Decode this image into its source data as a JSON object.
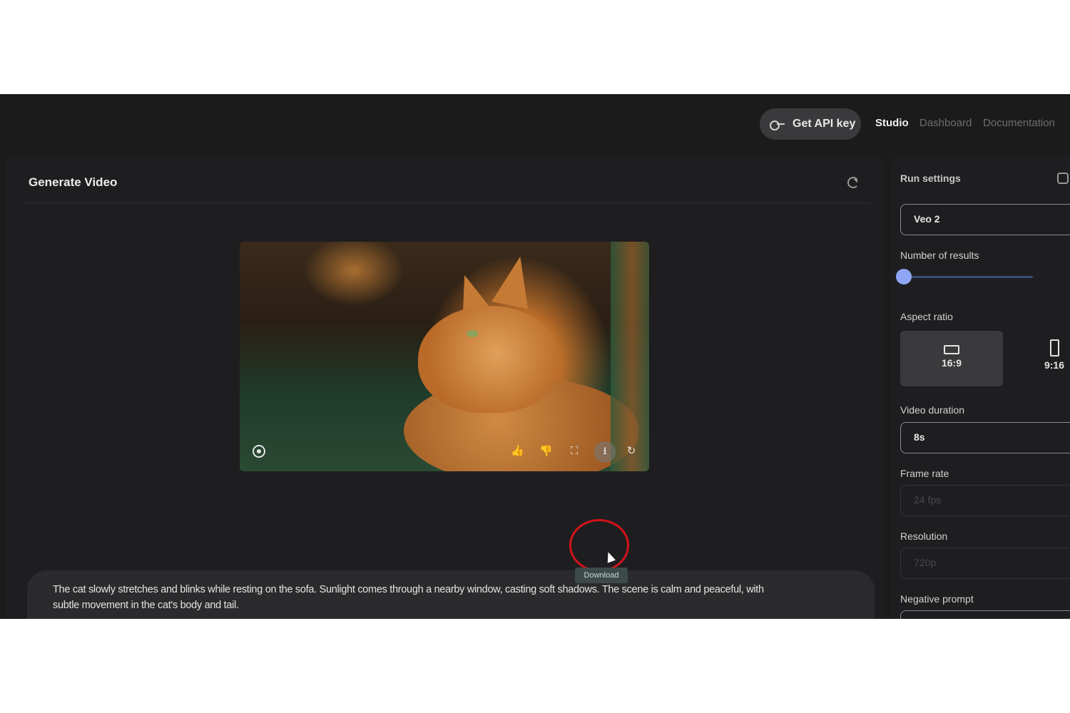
{
  "topnav": {
    "api_key_label": "Get API key",
    "studio": "Studio",
    "dashboard": "Dashboard",
    "documentation": "Documentation"
  },
  "main": {
    "title": "Generate Video",
    "tooltip": "Download",
    "prompt": "The cat slowly stretches and blinks while resting on the sofa. Sunlight comes through a nearby window, casting soft shadows. The scene is calm and peaceful, with subtle movement in the cat's body and tail."
  },
  "settings": {
    "title": "Run settings",
    "model": "Veo 2",
    "results_label": "Number of results",
    "results_value": 1,
    "aspect_label": "Aspect ratio",
    "aspect_options": [
      {
        "label": "16:9",
        "selected": true
      },
      {
        "label": "9:16",
        "selected": false
      }
    ],
    "duration_label": "Video duration",
    "duration_value": "8s",
    "frame_rate_label": "Frame rate",
    "frame_rate_value": "24 fps",
    "resolution_label": "Resolution",
    "resolution_value": "720p",
    "negative_prompt_label": "Negative prompt"
  },
  "colors": {
    "background": "#1b1b1c",
    "accent": "#8ea6f5",
    "highlight": "#d3131b"
  }
}
